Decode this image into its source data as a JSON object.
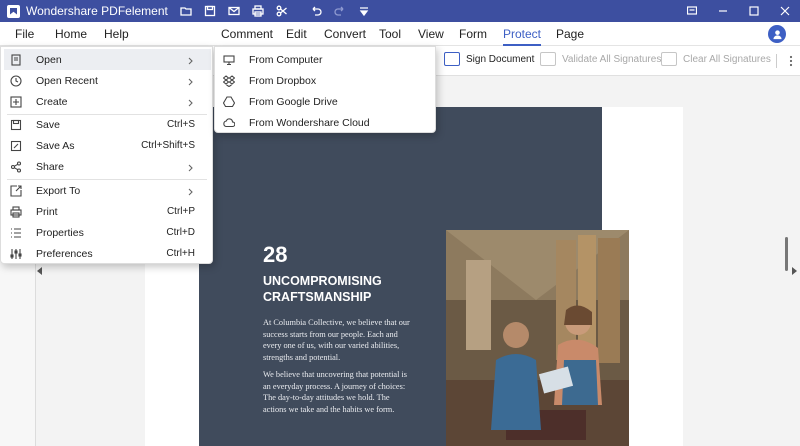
{
  "app": {
    "title": "Wondershare PDFelement"
  },
  "titlebar_icons": [
    "folder-open-icon",
    "save-icon",
    "mail-icon",
    "print-icon",
    "scissors-icon",
    "undo-icon",
    "redo-icon",
    "dropdown-icon"
  ],
  "window_controls": [
    "feedback-icon",
    "minimize-icon",
    "maximize-icon",
    "close-icon"
  ],
  "menubar": {
    "items": [
      {
        "label": "File"
      },
      {
        "label": "Home"
      },
      {
        "label": "Help"
      },
      {
        "label": "Comment"
      },
      {
        "label": "Edit"
      },
      {
        "label": "Convert"
      },
      {
        "label": "Tool"
      },
      {
        "label": "View"
      },
      {
        "label": "Form"
      },
      {
        "label": "Protect",
        "active": true
      },
      {
        "label": "Page"
      }
    ]
  },
  "toolbar": {
    "sign_document": "Sign Document",
    "validate_all": "Validate All Signatures",
    "clear_all": "Clear All Signatures"
  },
  "file_menu": {
    "items": [
      {
        "label": "Open",
        "icon": "open-file-icon",
        "shortcut": "",
        "submenu": true
      },
      {
        "label": "Open Recent",
        "icon": "clock-icon",
        "shortcut": "",
        "submenu": true
      },
      {
        "label": "Create",
        "icon": "create-icon",
        "shortcut": "",
        "submenu": true
      },
      {
        "label": "Save",
        "icon": "save-icon",
        "shortcut": "Ctrl+S",
        "submenu": false
      },
      {
        "label": "Save As",
        "icon": "save-as-icon",
        "shortcut": "Ctrl+Shift+S",
        "submenu": false
      },
      {
        "label": "Share",
        "icon": "share-icon",
        "shortcut": "",
        "submenu": true
      },
      {
        "label": "Export To",
        "icon": "export-icon",
        "shortcut": "",
        "submenu": true
      },
      {
        "label": "Print",
        "icon": "print-icon",
        "shortcut": "Ctrl+P",
        "submenu": false
      },
      {
        "label": "Properties",
        "icon": "properties-icon",
        "shortcut": "Ctrl+D",
        "submenu": false
      },
      {
        "label": "Preferences",
        "icon": "preferences-icon",
        "shortcut": "Ctrl+H",
        "submenu": false
      }
    ]
  },
  "open_submenu": {
    "items": [
      {
        "label": "From Computer",
        "icon": "computer-icon"
      },
      {
        "label": "From Dropbox",
        "icon": "dropbox-icon"
      },
      {
        "label": "From Google Drive",
        "icon": "google-drive-icon"
      },
      {
        "label": "From Wondershare Cloud",
        "icon": "cloud-icon"
      }
    ]
  },
  "document": {
    "number": "28",
    "heading": "UNCOMPROMISING CRAFTSMANSHIP",
    "paragraph1": "At Columbia Collective, we believe that our success starts from our people. Each and every one of us, with our varied abilities, strengths and potential.",
    "paragraph2": "We believe that uncovering that potential is an everyday process. A journey of choices: The day-to-day attitudes we hold. The actions we take and the habits we form."
  }
}
